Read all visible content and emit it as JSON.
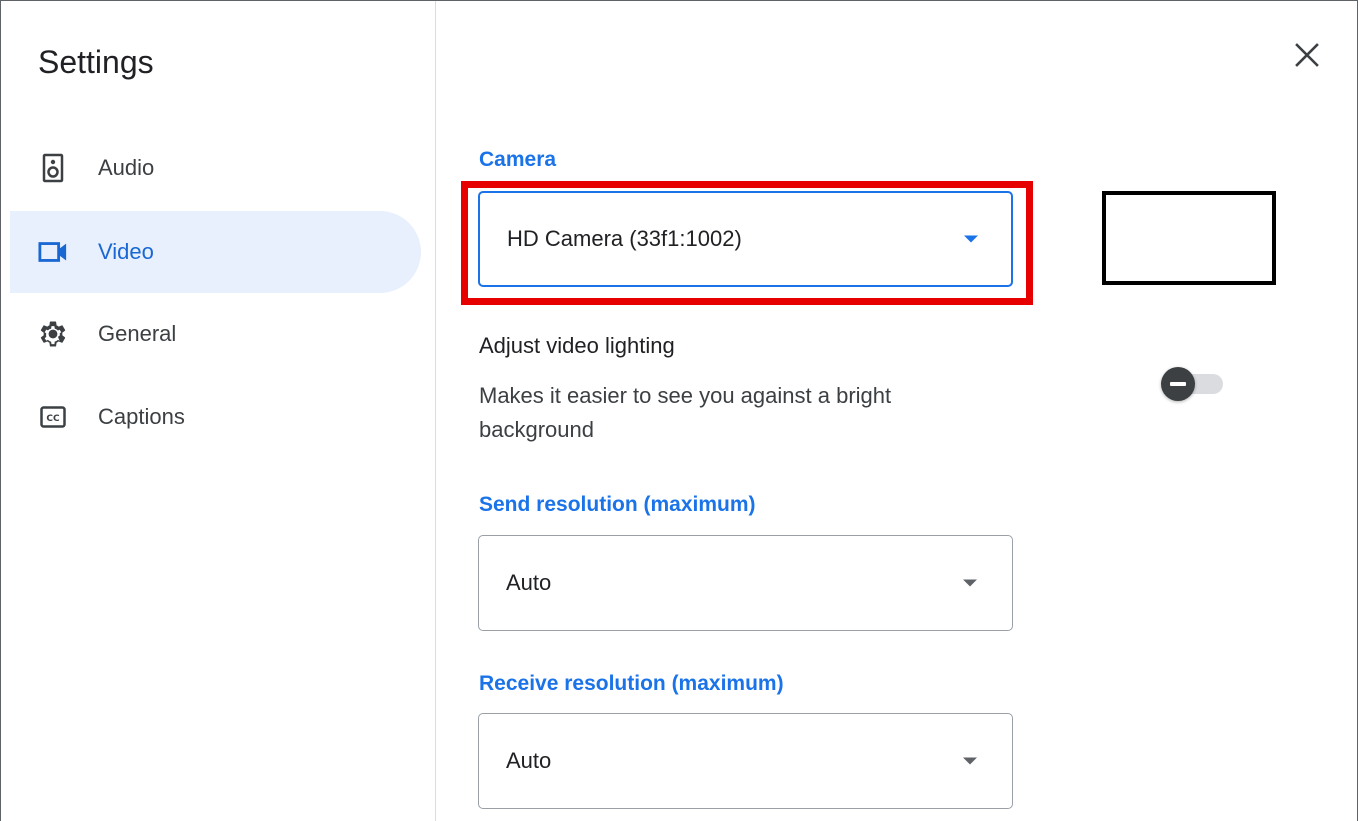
{
  "window": {
    "title": "Settings"
  },
  "sidebar": {
    "items": [
      {
        "label": "Audio",
        "icon": "speaker-icon",
        "active": false
      },
      {
        "label": "Video",
        "icon": "videocam-icon",
        "active": true
      },
      {
        "label": "General",
        "icon": "gear-icon",
        "active": false
      },
      {
        "label": "Captions",
        "icon": "closed-captions-icon",
        "active": false
      }
    ]
  },
  "content": {
    "camera": {
      "label": "Camera",
      "value": "HD Camera (33f1:1002)"
    },
    "lighting": {
      "heading": "Adjust video lighting",
      "description": "Makes it easier to see you against a bright background",
      "enabled": false
    },
    "send_resolution": {
      "label": "Send resolution (maximum)",
      "value": "Auto"
    },
    "receive_resolution": {
      "label": "Receive resolution (maximum)",
      "value": "Auto"
    }
  },
  "colors": {
    "accent": "#1a73e8",
    "active_nav_bg": "#e8f0fe",
    "highlight": "#e60000"
  }
}
